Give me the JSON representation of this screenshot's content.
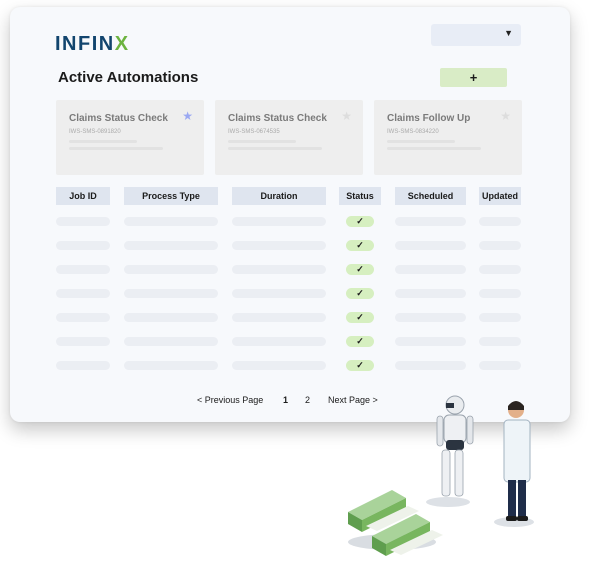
{
  "brand": {
    "part1": "INFIN",
    "part2": "X"
  },
  "header": {
    "dropdown_value": ""
  },
  "page": {
    "title": "Active Automations",
    "add_label": "+"
  },
  "automation_cards": [
    {
      "title": "Claims Status Check",
      "id": "IWS-SMS-0891820",
      "starred": true
    },
    {
      "title": "Claims Status Check",
      "id": "IWS-SMS-0674535",
      "starred": false
    },
    {
      "title": "Claims Follow Up",
      "id": "IWS-SMS-0834220",
      "starred": false
    }
  ],
  "table": {
    "columns": [
      "Job ID",
      "Process Type",
      "Duration",
      "Status",
      "Scheduled",
      "Updated"
    ],
    "row_count": 7,
    "status_glyph": "✓"
  },
  "pagination": {
    "prev": "< Previous Page",
    "pages": [
      "1",
      "2"
    ],
    "current": "1",
    "next": "Next Page >"
  },
  "colors": {
    "brand_blue": "#12456e",
    "brand_green": "#6cb33f",
    "star_active": "#9aa8f2",
    "status_ok": "#d6efc0"
  }
}
